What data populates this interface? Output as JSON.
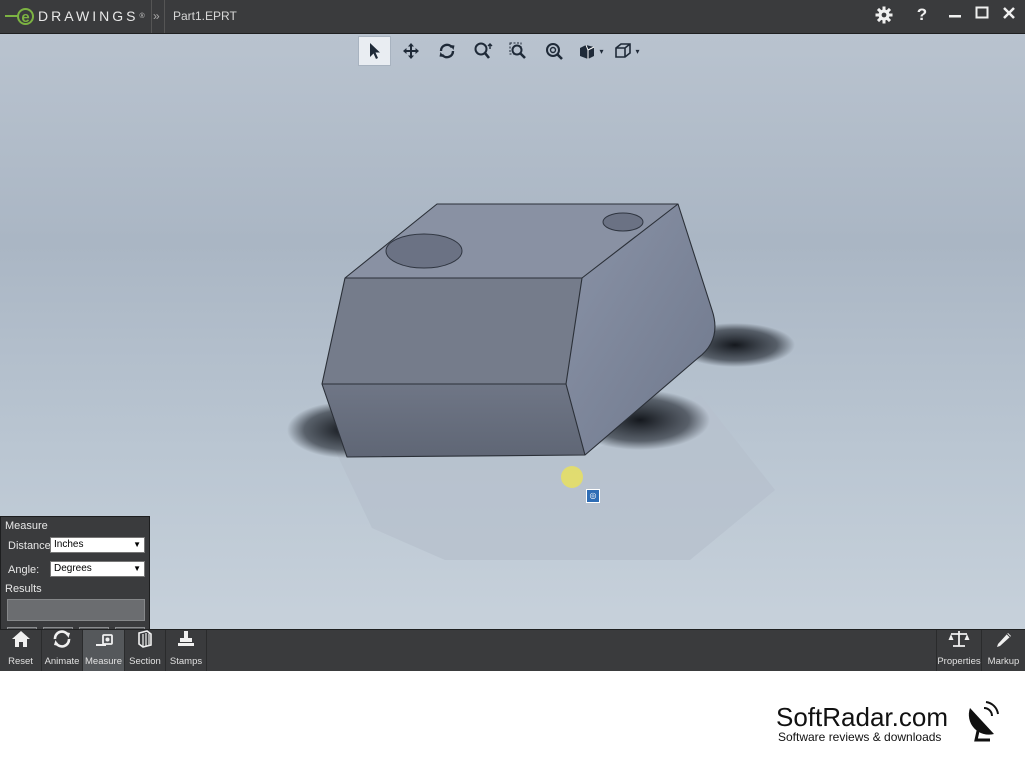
{
  "app": {
    "brand": "DRAWINGS",
    "brand_letter": "e",
    "breadcrumb_arrow": "»",
    "document": "Part1.EPRT"
  },
  "titlebar": {
    "settings_icon": "gear-icon",
    "help_label": "?",
    "minimize_icon": "minimize-icon",
    "maximize_icon": "maximize-icon",
    "close_icon": "close-icon"
  },
  "view_toolbar": {
    "tools": [
      "select-icon",
      "pan-icon",
      "rotate-icon",
      "zoom-icon",
      "zoom-to-area-icon",
      "zoom-to-fit-icon",
      "display-style-icon",
      "view-orientation-icon"
    ]
  },
  "measure_panel": {
    "title": "Measure",
    "distance_label": "Distance:",
    "distance_value": "Inches",
    "angle_label": "Angle:",
    "angle_value": "Degrees",
    "results_label": "Results",
    "results_value": ""
  },
  "bottom_toolbar": {
    "left": [
      {
        "label": "Reset",
        "icon": "home-icon"
      },
      {
        "label": "Animate",
        "icon": "animate-icon"
      },
      {
        "label": "Measure",
        "icon": "measure-icon",
        "active": true
      },
      {
        "label": "Section",
        "icon": "section-icon"
      },
      {
        "label": "Stamps",
        "icon": "stamp-icon"
      }
    ],
    "right": [
      {
        "label": "Properties",
        "icon": "scales-icon"
      },
      {
        "label": "Markup",
        "icon": "pencil-icon"
      }
    ]
  },
  "watermark": {
    "main": "SoftRadar.com",
    "sub": "Software reviews & downloads"
  },
  "colors": {
    "titlebar": "#3a3b3d",
    "accent_green": "#7cb342",
    "viewport_top": "#b9c3cf",
    "viewport_bottom": "#c7d1db",
    "part_front": "#666d7a",
    "part_top": "#8891a4",
    "part_side": "#7f889c"
  }
}
